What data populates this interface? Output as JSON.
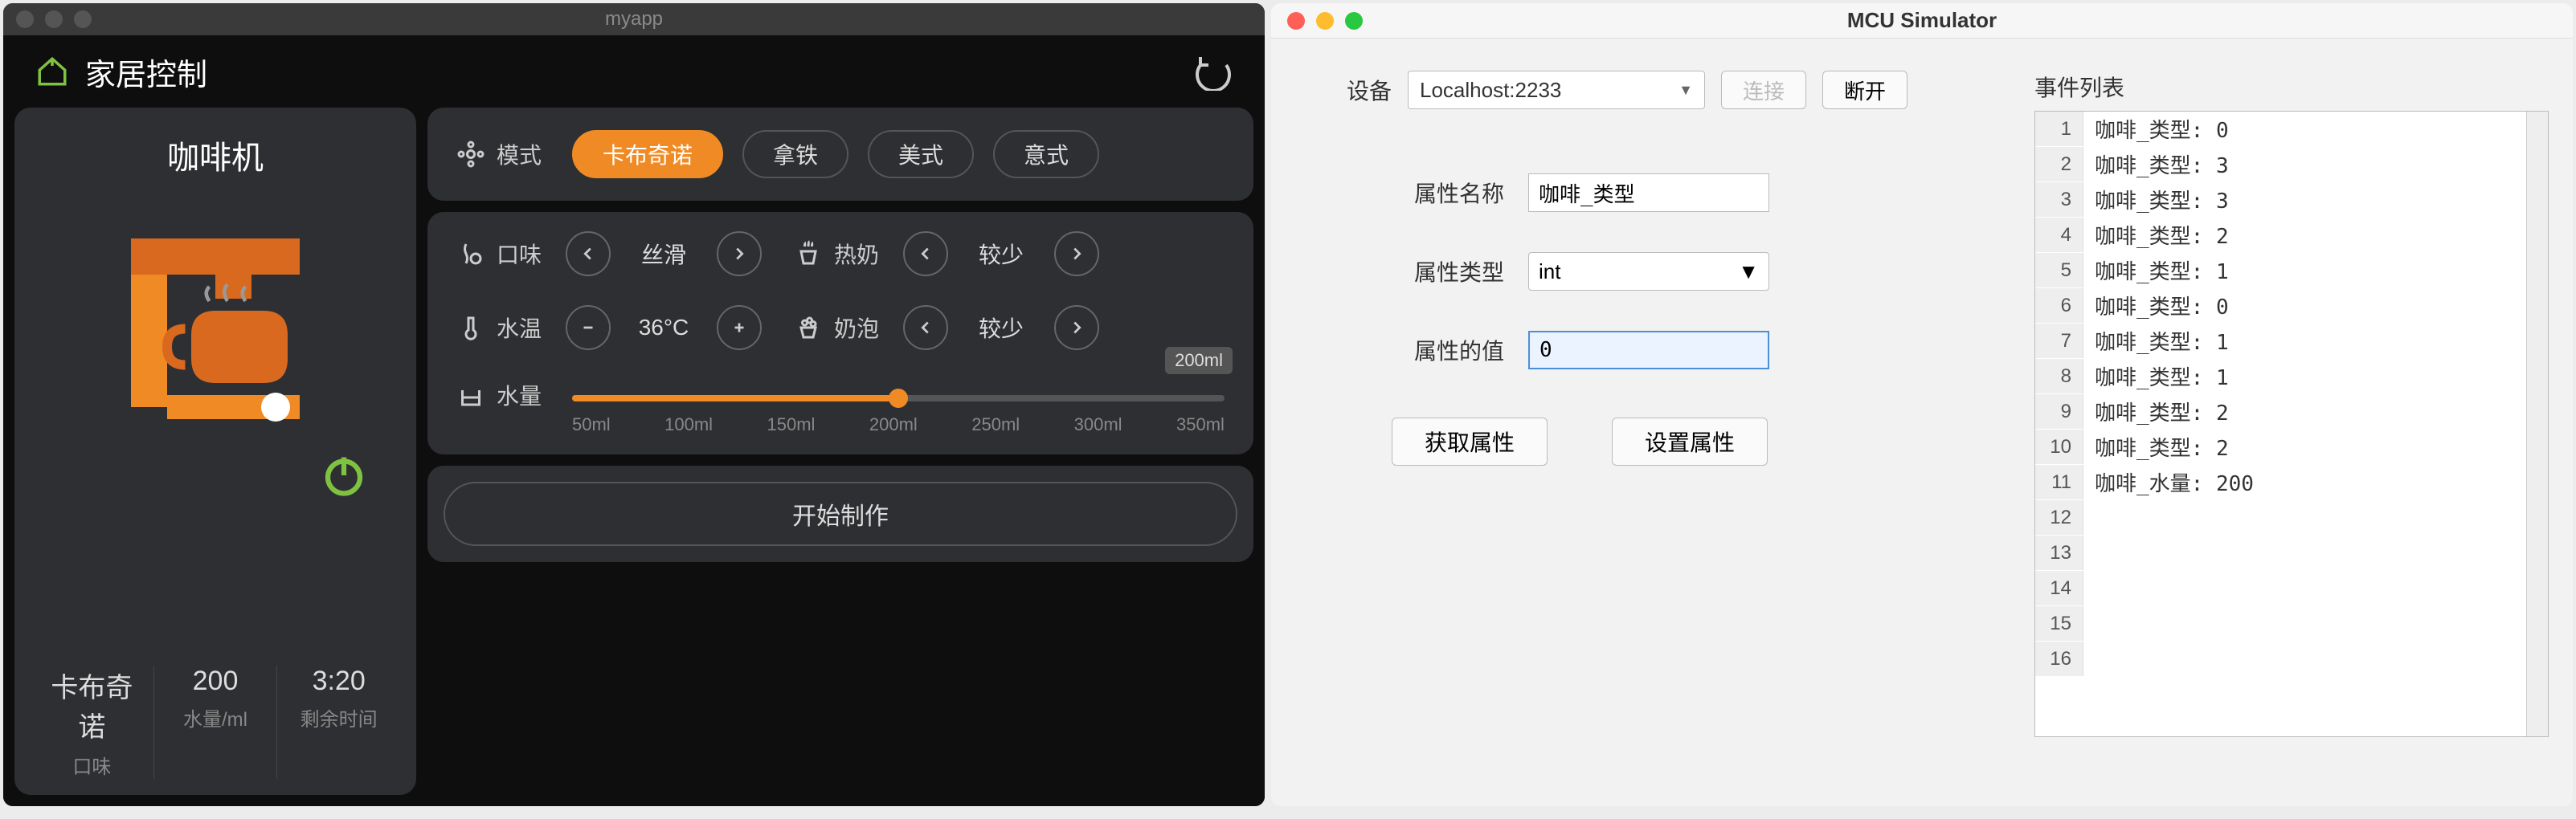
{
  "left_window": {
    "title": "myapp",
    "header_title": "家居控制",
    "device": {
      "name": "咖啡机",
      "stats": [
        {
          "value": "卡布奇诺",
          "label": "口味"
        },
        {
          "value": "200",
          "label": "水量/ml"
        },
        {
          "value": "3:20",
          "label": "剩余时间"
        }
      ]
    },
    "mode": {
      "label": "模式",
      "options": [
        "卡布奇诺",
        "拿铁",
        "美式",
        "意式"
      ],
      "active": "卡布奇诺"
    },
    "taste": {
      "label": "口味",
      "value": "丝滑"
    },
    "milk": {
      "label": "热奶",
      "value": "较少"
    },
    "temp": {
      "label": "水温",
      "value": "36°C"
    },
    "foam": {
      "label": "奶泡",
      "value": "较少"
    },
    "water": {
      "label": "水量",
      "ticks": [
        "50ml",
        "100ml",
        "150ml",
        "200ml",
        "250ml",
        "300ml",
        "350ml"
      ],
      "tooltip": "200ml",
      "fill_percent": 50
    },
    "start_label": "开始制作"
  },
  "right_window": {
    "title": "MCU Simulator",
    "device_label": "设备",
    "device_host": "Localhost:2233",
    "connect_label": "连接",
    "disconnect_label": "断开",
    "attr_name_label": "属性名称",
    "attr_name_value": "咖啡_类型",
    "attr_type_label": "属性类型",
    "attr_type_value": "int",
    "attr_val_label": "属性的值",
    "attr_val_value": "0",
    "get_btn": "获取属性",
    "set_btn": "设置属性",
    "events_title": "事件列表",
    "events": [
      "咖啡_类型: 0",
      "咖啡_类型: 3",
      "咖啡_类型: 3",
      "咖啡_类型: 2",
      "咖啡_类型: 1",
      "咖啡_类型: 0",
      "咖啡_类型: 1",
      "咖啡_类型: 1",
      "咖啡_类型: 2",
      "咖啡_类型: 2",
      "咖啡_水量: 200",
      "",
      "",
      "",
      "",
      ""
    ]
  },
  "chart_data": {
    "type": "table",
    "title": "事件列表",
    "rows": [
      {
        "index": 1,
        "text": "咖啡_类型: 0"
      },
      {
        "index": 2,
        "text": "咖啡_类型: 3"
      },
      {
        "index": 3,
        "text": "咖啡_类型: 3"
      },
      {
        "index": 4,
        "text": "咖啡_类型: 2"
      },
      {
        "index": 5,
        "text": "咖啡_类型: 1"
      },
      {
        "index": 6,
        "text": "咖啡_类型: 0"
      },
      {
        "index": 7,
        "text": "咖啡_类型: 1"
      },
      {
        "index": 8,
        "text": "咖啡_类型: 1"
      },
      {
        "index": 9,
        "text": "咖啡_类型: 2"
      },
      {
        "index": 10,
        "text": "咖啡_类型: 2"
      },
      {
        "index": 11,
        "text": "咖啡_水量: 200"
      }
    ]
  }
}
